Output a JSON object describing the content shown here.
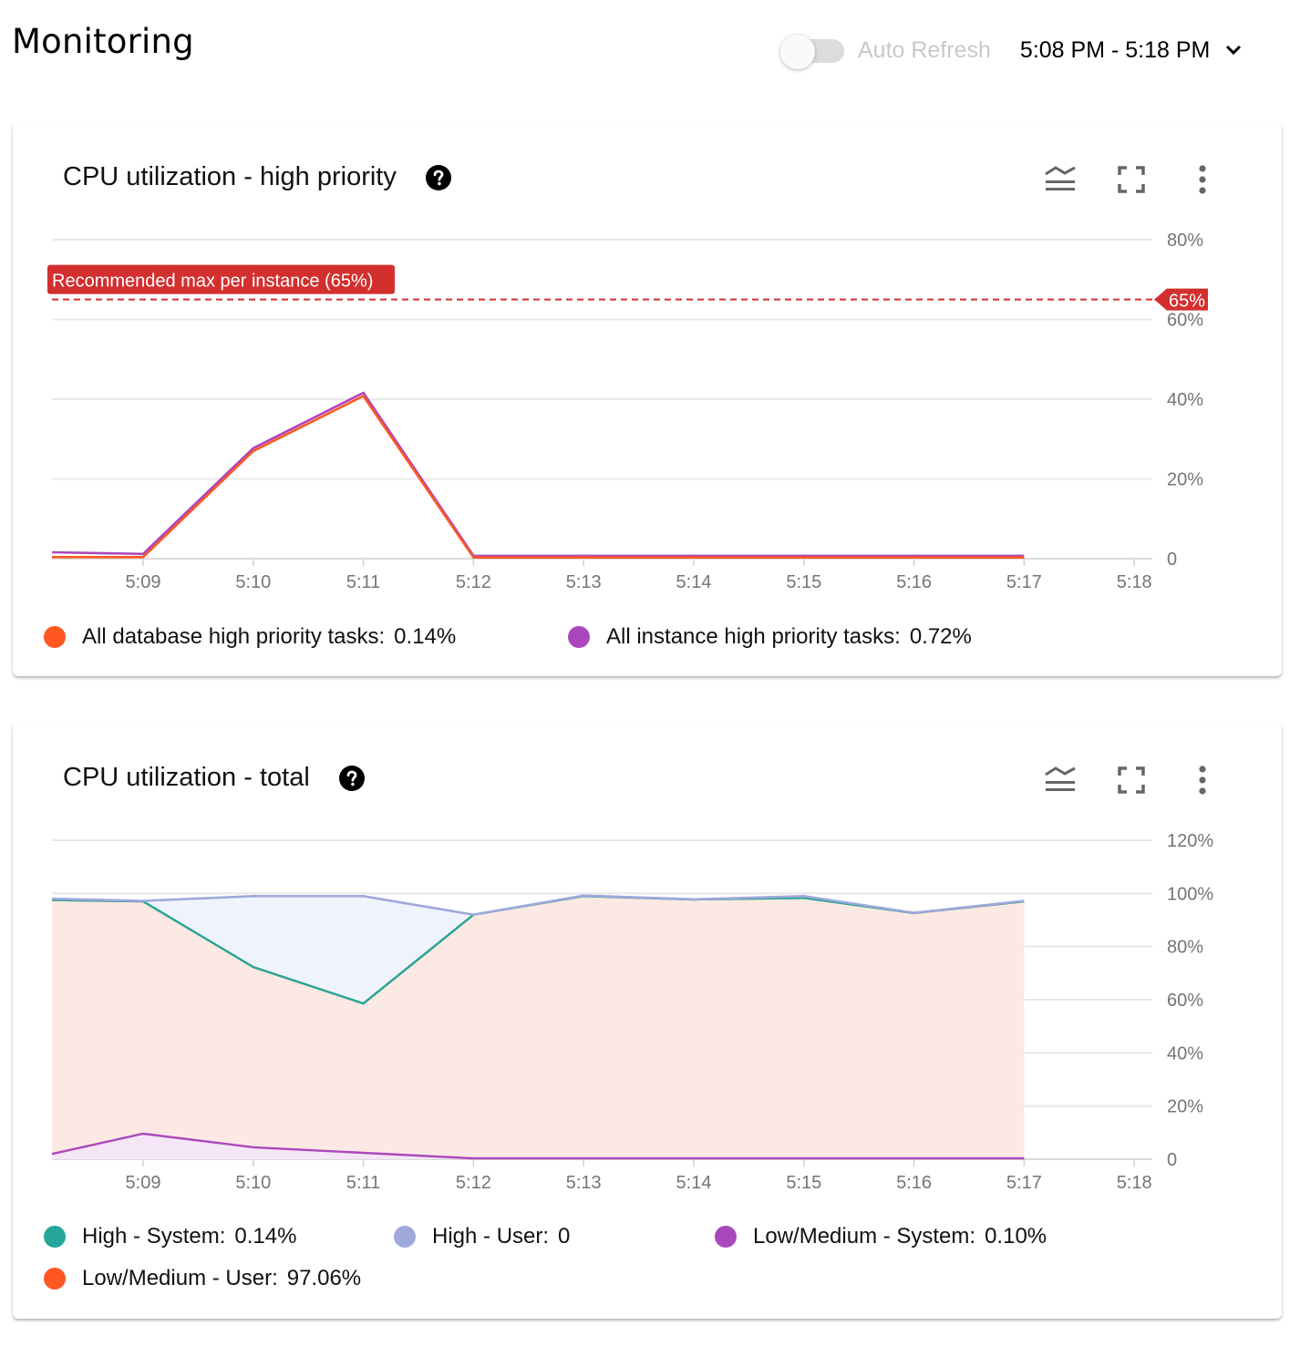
{
  "header": {
    "title": "Monitoring",
    "auto_refresh_label": "Auto Refresh",
    "auto_refresh_on": false,
    "time_range": "5:08 PM - 5:18 PM"
  },
  "colors": {
    "orange": "#ff5722",
    "purple": "#ab47bc",
    "teal": "#26a69a",
    "lavender": "#9fa8da",
    "threshold_red": "#d32f2f",
    "orange_fill": "#fde9e3",
    "lavender_fill": "#eff3fc",
    "purple_fill": "#f5e6f7"
  },
  "chart_data": [
    {
      "type": "line",
      "title": "CPU utilization - high priority",
      "x": [
        "5:08:10",
        "5:09",
        "5:10",
        "5:11",
        "5:12",
        "5:13",
        "5:14",
        "5:15",
        "5:16",
        "5:17"
      ],
      "x_ticks": [
        "5:09",
        "5:10",
        "5:11",
        "5:12",
        "5:13",
        "5:14",
        "5:15",
        "5:16",
        "5:17",
        "5:18"
      ],
      "y_ticks": [
        "0",
        "20%",
        "40%",
        "60%",
        "80%"
      ],
      "ylim": [
        0,
        80
      ],
      "grid": true,
      "y_axis_side": "right",
      "threshold": {
        "value": 65,
        "label": "Recommended max per instance (65%)",
        "tag": "65%"
      },
      "series": [
        {
          "name": "All database high priority tasks",
          "current": "0.14%",
          "color": "#ff5722",
          "values": [
            0.4,
            0.4,
            27.0,
            40.8,
            0.3,
            0.3,
            0.3,
            0.3,
            0.3,
            0.3
          ]
        },
        {
          "name": "All instance high priority tasks",
          "current": "0.72%",
          "color": "#ab47bc",
          "values": [
            1.6,
            1.2,
            27.7,
            41.6,
            0.7,
            0.7,
            0.7,
            0.7,
            0.7,
            0.7
          ]
        }
      ],
      "legend_position": "bottom"
    },
    {
      "type": "area",
      "stacked": true,
      "title": "CPU utilization - total",
      "x": [
        "5:08:10",
        "5:09",
        "5:10",
        "5:11",
        "5:12",
        "5:13",
        "5:14",
        "5:15",
        "5:16",
        "5:17"
      ],
      "x_ticks": [
        "5:09",
        "5:10",
        "5:11",
        "5:12",
        "5:13",
        "5:14",
        "5:15",
        "5:16",
        "5:17",
        "5:18"
      ],
      "y_ticks": [
        "0",
        "20%",
        "40%",
        "60%",
        "80%",
        "100%",
        "120%"
      ],
      "ylim": [
        0,
        120
      ],
      "grid": true,
      "y_axis_side": "right",
      "series": [
        {
          "name": "High - System",
          "current": "0.14%",
          "color": "#26a69a",
          "cumulative_values": [
            97.5,
            97.0,
            72.3,
            58.6,
            92.0,
            99.0,
            97.7,
            98.3,
            92.6,
            97.0
          ]
        },
        {
          "name": "High - User",
          "current": "0",
          "color": "#9fa8da",
          "cumulative_values": [
            98.0,
            97.2,
            99.0,
            99.0,
            92.0,
            99.2,
            97.8,
            99.0,
            92.7,
            97.2
          ]
        },
        {
          "name": "Low/Medium - System",
          "current": "0.10%",
          "color": "#ab47bc",
          "values": [
            2.0,
            9.6,
            4.5,
            2.4,
            0.3,
            0.3,
            0.3,
            0.3,
            0.3,
            0.3
          ]
        },
        {
          "name": "Low/Medium - User",
          "current": "97.06%",
          "color": "#ff5722",
          "cumulative_values": [
            97.5,
            97.0,
            72.3,
            58.6,
            92.0,
            99.0,
            97.7,
            98.3,
            92.6,
            97.0
          ]
        }
      ],
      "legend_position": "bottom"
    }
  ]
}
